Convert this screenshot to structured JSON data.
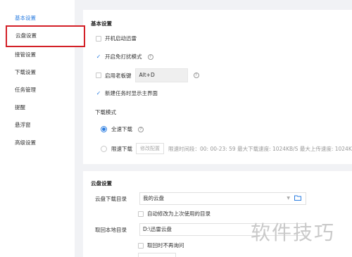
{
  "sidebar": {
    "items": [
      {
        "label": "基本设置",
        "state": "active"
      },
      {
        "label": "云盘设置",
        "state": "highlighted"
      },
      {
        "label": "接管设置"
      },
      {
        "label": "下载设置"
      },
      {
        "label": "任务管理"
      },
      {
        "label": "提醒"
      },
      {
        "label": "悬浮窗"
      },
      {
        "label": "高级设置"
      }
    ]
  },
  "basic": {
    "title": "基本设置",
    "autostart_label": "开机启动迅雷",
    "autostart_checked": false,
    "no_disturb_label": "开启免打扰模式",
    "no_disturb_checked": true,
    "boss_key_label": "启用老板键",
    "boss_key_checked": false,
    "boss_key_value": "Alt+D",
    "show_main_label": "新建任务时显示主界面",
    "show_main_checked": true,
    "download_mode_title": "下载模式",
    "full_speed_label": "全速下载",
    "full_speed_selected": true,
    "limit_label": "限速下载",
    "limit_selected": false,
    "modify_config_label": "修改配置",
    "limit_info": "限速时间段：00: 00-23: 59  最大下载速度: 1024KB/S  最大上传速度: 1024K"
  },
  "cloud": {
    "title": "云盘设置",
    "download_dir_label": "云盘下载目录",
    "download_dir_value": "我的云盘",
    "auto_change_label": "自动修改为上次使用的目录",
    "auto_change_checked": false,
    "local_dir_label": "取回本地目录",
    "local_dir_value": "D:\\迅雷云盘",
    "no_ask_label": "取回时不再询问",
    "no_ask_checked": false
  },
  "watermark": "软件技巧",
  "colors": {
    "accent": "#2b7de0",
    "highlight_border": "#d32027",
    "background": "#f1f2f5"
  },
  "icons": {
    "help": "question-circle-icon",
    "folder": "folder-icon",
    "check": "checkmark-icon"
  }
}
